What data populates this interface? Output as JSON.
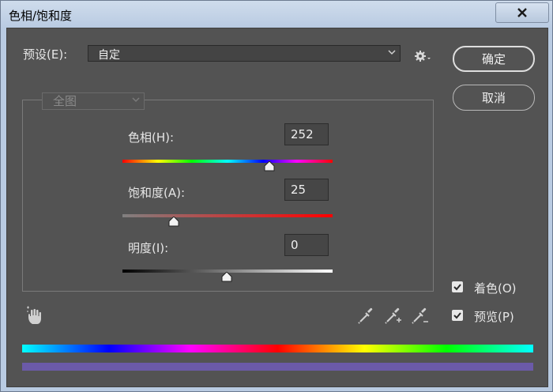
{
  "window": {
    "title": "色相/饱和度"
  },
  "preset": {
    "label": "预设(E):",
    "value": "自定"
  },
  "buttons": {
    "ok": "确定",
    "cancel": "取消"
  },
  "channel": {
    "value": "全图"
  },
  "sliders": {
    "hue": {
      "label": "色相(H):",
      "value": "252",
      "fraction": 0.7
    },
    "saturation": {
      "label": "饱和度(A):",
      "value": "25",
      "fraction": 0.25
    },
    "lightness": {
      "label": "明度(I):",
      "value": "0",
      "fraction": 0.5
    }
  },
  "options": {
    "colorize": {
      "label": "着色(O)",
      "checked": true
    },
    "preview": {
      "label": "预览(P)",
      "checked": true
    }
  },
  "colors": {
    "colorized_bar": "#6b5aa8"
  }
}
